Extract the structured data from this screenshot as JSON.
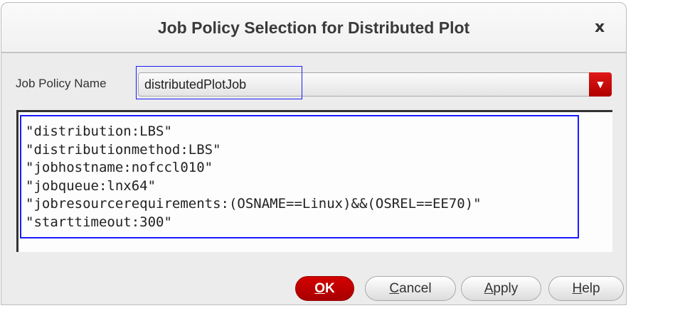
{
  "dialog": {
    "title": "Job Policy Selection for Distributed Plot",
    "close_label": "x"
  },
  "policy": {
    "label": "Job Policy Name",
    "value": "distributedPlotJob"
  },
  "properties": [
    "\"distribution:LBS\"",
    "\"distributionmethod:LBS\"",
    "\"jobhostname:nofccl010\"",
    "\"jobqueue:lnx64\"",
    "\"jobresourcerequirements:(OSNAME==Linux)&&(OSREL==EE70)\"",
    "\"starttimeout:300\""
  ],
  "buttons": {
    "ok": {
      "mnemonic": "O",
      "rest": "K"
    },
    "cancel": {
      "mnemonic": "C",
      "rest": "ancel"
    },
    "apply": {
      "mnemonic": "A",
      "rest": "pply"
    },
    "help": {
      "mnemonic": "H",
      "rest": "elp"
    }
  },
  "colors": {
    "accent": "#c00000",
    "highlight": "#1a1aff"
  }
}
